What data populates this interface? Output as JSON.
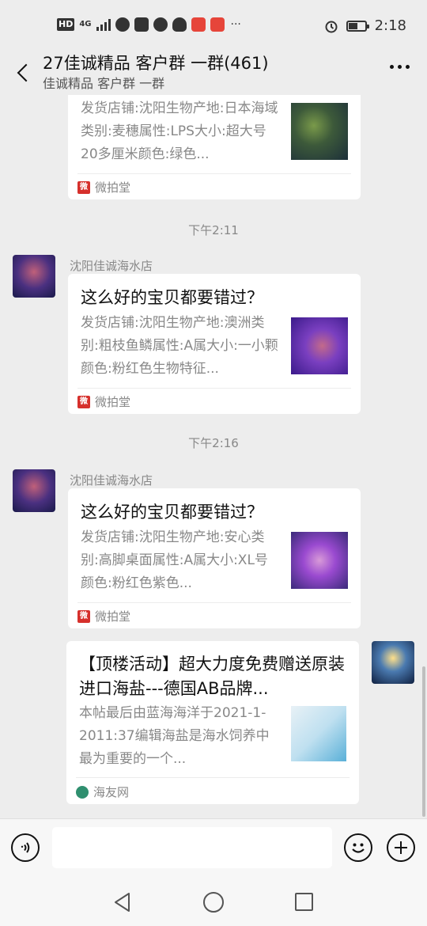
{
  "status_bar": {
    "hd": "HD",
    "signal": "4G",
    "time": "2:18"
  },
  "header": {
    "title": "27佳诚精品 客户群 一群(461)",
    "subtitle": "佳诚精品 客户群 一群"
  },
  "messages": [
    {
      "desc": "发货店铺:沈阳生物产地:日本海域类别:麦穗属性:LPS大小:超大号20多厘米颜色:绿色...",
      "source": "微拍堂",
      "thumb_icon": "coral-photo-1"
    },
    {
      "timestamp": "下午2:11",
      "sender": "沈阳佳诚海水店",
      "title": "这么好的宝贝都要错过？",
      "desc": "发货店铺:沈阳生物产地:澳洲类别:粗枝鱼鳞属性:A属大小:一小颗颜色:粉红色生物特征...",
      "source": "微拍堂",
      "thumb_icon": "coral-photo-2"
    },
    {
      "timestamp": "下午2:16",
      "sender": "沈阳佳诚海水店",
      "title": "这么好的宝贝都要错过？",
      "desc": "发货店铺:沈阳生物产地:安心类别:高脚桌面属性:A属大小:XL号颜色:粉红色紫色...",
      "source": "微拍堂",
      "thumb_icon": "coral-photo-3"
    },
    {
      "title": "【顶楼活动】超大力度免费赠送原装进口海盐---德国AB品牌...",
      "desc": "本帖最后由蓝海海洋于2021-1-2011:37编辑海盐是海水饲养中最为重要的一个...",
      "source": "海友网",
      "thumb_icon": "salt-product-photo"
    }
  ],
  "input": {
    "placeholder": ""
  },
  "colors": {
    "background": "#ededed",
    "card": "#ffffff",
    "weipaitang_red": "#d6302c",
    "haiyou_green": "#2f8f6f"
  }
}
